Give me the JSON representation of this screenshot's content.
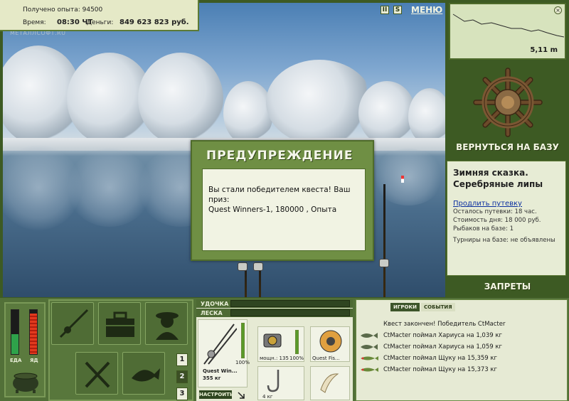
{
  "info": {
    "exp_label": "Получено опыта:",
    "exp_value": "94500",
    "time_label": "Время:",
    "time_value": "08:30 ЧТ",
    "money_label": "Деньги:",
    "money_value": "849 623 823 руб."
  },
  "watermark": "МЕТАЛЛСОФТ.RU",
  "top_icons": {
    "pause": "II",
    "sound": "S",
    "menu_label": "МЕНЮ"
  },
  "map": {
    "depth": "5,11 m",
    "close_glyph": "×"
  },
  "right": {
    "home_button": "ВЕРНУТЬСЯ НА БАЗУ",
    "place_name_1": "Зимняя сказка.",
    "place_name_2": "Серебряные липы",
    "extend_link": "Продлить путевку",
    "remaining": "Осталось путевки: 18 час.",
    "cost": "Стоимость дня: 18 000 руб.",
    "fishers": "Рыбаков на базе: 1",
    "tournaments": "Турниры на базе: не объявлены",
    "bans_button": "ЗАПРЕТЫ"
  },
  "dialog": {
    "title": "ПРЕДУПРЕЖДЕНИЕ",
    "text_1": "Вы стали победителем квеста! Ваш приз:",
    "text_2": "Quest Winners-1, 180000 , Опыта"
  },
  "meters": {
    "food_label": "ЕДА",
    "poison_label": "ЯД",
    "food_level": 0.45,
    "poison_level": 0.92
  },
  "pages": [
    "1",
    "2",
    "3"
  ],
  "tackle": {
    "rod_label": "УДОЧКА",
    "line_label": "ЛЕСКА",
    "rod_name": "Quest Win...",
    "rod_weight": "355 кг",
    "rod_pct": "100%",
    "reel_cap": "мощн.: 135",
    "reel_pct": "100%",
    "line_cap": "Quest Fis...",
    "hook_cap": "4 кг",
    "setup_button": "НАСТРОИТЬ"
  },
  "chat": {
    "tab_players": "ИГРОКИ",
    "tab_events": "СОБЫТИЯ",
    "messages": [
      "Квест закончен! Победитель CtMacter",
      "CtMacter поймал Хариуса на 1,039 кг",
      "CtMacter поймал Хариуса на 1,059 кг",
      "CtMacter поймал Щуку на 15,359 кг",
      "CtMacter поймал Щуку на 15,373 кг"
    ]
  },
  "colors": {
    "panel_green": "#527038",
    "accent": "#6f8f44",
    "link_blue": "#0b2fa0"
  }
}
